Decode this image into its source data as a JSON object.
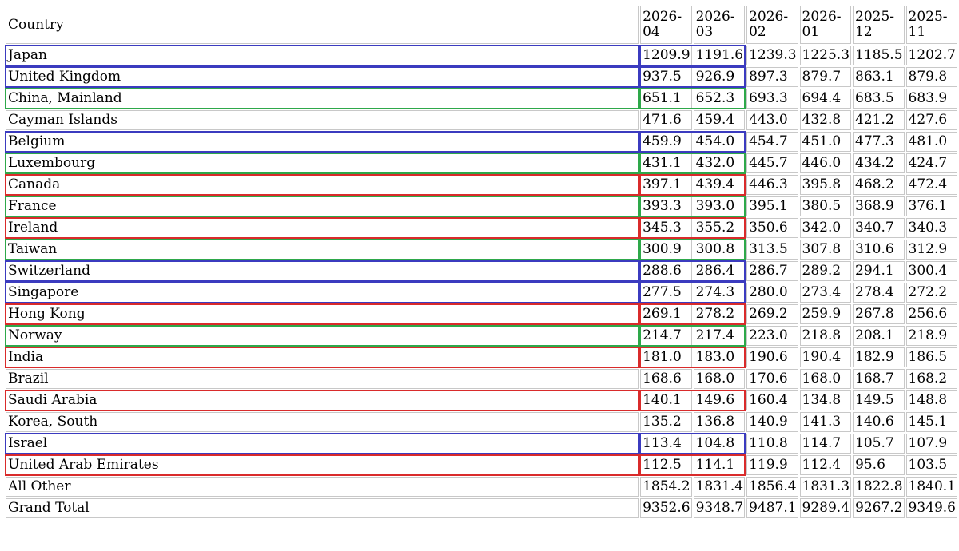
{
  "header": {
    "country": "Country",
    "periods": [
      [
        "2026-",
        "04"
      ],
      [
        "2026-",
        "03"
      ],
      [
        "2026-",
        "02"
      ],
      [
        "2026-",
        "01"
      ],
      [
        "2025-",
        "12"
      ],
      [
        "2025-",
        "11"
      ]
    ]
  },
  "rows": [
    {
      "country": "Japan",
      "values": [
        "1209.9",
        "1191.6",
        "1239.3",
        "1225.3",
        "1185.5",
        "1202.7"
      ],
      "highlight": "#3b3bbf"
    },
    {
      "country": "United Kingdom",
      "values": [
        "937.5",
        "926.9",
        "897.3",
        "879.7",
        "863.1",
        "879.8"
      ],
      "highlight": "#3b3bbf"
    },
    {
      "country": "China, Mainland",
      "values": [
        "651.1",
        "652.3",
        "693.3",
        "694.4",
        "683.5",
        "683.9"
      ],
      "highlight": "#2ea84a"
    },
    {
      "country": "Cayman Islands",
      "values": [
        "471.6",
        "459.4",
        "443.0",
        "432.8",
        "421.2",
        "427.6"
      ],
      "highlight": null
    },
    {
      "country": "Belgium",
      "values": [
        "459.9",
        "454.0",
        "454.7",
        "451.0",
        "477.3",
        "481.0"
      ],
      "highlight": "#3b3bbf"
    },
    {
      "country": "Luxembourg",
      "values": [
        "431.1",
        "432.0",
        "445.7",
        "446.0",
        "434.2",
        "424.7"
      ],
      "highlight": "#2ea84a"
    },
    {
      "country": "Canada",
      "values": [
        "397.1",
        "439.4",
        "446.3",
        "395.8",
        "468.2",
        "472.4"
      ],
      "highlight": "#d92b2b"
    },
    {
      "country": "France",
      "values": [
        "393.3",
        "393.0",
        "395.1",
        "380.5",
        "368.9",
        "376.1"
      ],
      "highlight": "#2ea84a"
    },
    {
      "country": "Ireland",
      "values": [
        "345.3",
        "355.2",
        "350.6",
        "342.0",
        "340.7",
        "340.3"
      ],
      "highlight": "#d92b2b"
    },
    {
      "country": "Taiwan",
      "values": [
        "300.9",
        "300.8",
        "313.5",
        "307.8",
        "310.6",
        "312.9"
      ],
      "highlight": "#2ea84a"
    },
    {
      "country": "Switzerland",
      "values": [
        "288.6",
        "286.4",
        "286.7",
        "289.2",
        "294.1",
        "300.4"
      ],
      "highlight": "#3b3bbf"
    },
    {
      "country": "Singapore",
      "values": [
        "277.5",
        "274.3",
        "280.0",
        "273.4",
        "278.4",
        "272.2"
      ],
      "highlight": "#3b3bbf"
    },
    {
      "country": "Hong Kong",
      "values": [
        "269.1",
        "278.2",
        "269.2",
        "259.9",
        "267.8",
        "256.6"
      ],
      "highlight": "#d92b2b"
    },
    {
      "country": "Norway",
      "values": [
        "214.7",
        "217.4",
        "223.0",
        "218.8",
        "208.1",
        "218.9"
      ],
      "highlight": "#2ea84a"
    },
    {
      "country": "India",
      "values": [
        "181.0",
        "183.0",
        "190.6",
        "190.4",
        "182.9",
        "186.5"
      ],
      "highlight": "#d92b2b"
    },
    {
      "country": "Brazil",
      "values": [
        "168.6",
        "168.0",
        "170.6",
        "168.0",
        "168.7",
        "168.2"
      ],
      "highlight": null
    },
    {
      "country": "Saudi Arabia",
      "values": [
        "140.1",
        "149.6",
        "160.4",
        "134.8",
        "149.5",
        "148.8"
      ],
      "highlight": "#d92b2b"
    },
    {
      "country": "Korea, South",
      "values": [
        "135.2",
        "136.8",
        "140.9",
        "141.3",
        "140.6",
        "145.1"
      ],
      "highlight": null
    },
    {
      "country": "Israel",
      "values": [
        "113.4",
        "104.8",
        "110.8",
        "114.7",
        "105.7",
        "107.9"
      ],
      "highlight": "#3b3bbf"
    },
    {
      "country": "United Arab Emirates",
      "values": [
        "112.5",
        "114.1",
        "119.9",
        "112.4",
        "95.6",
        "103.5"
      ],
      "highlight": "#d92b2b"
    },
    {
      "country": "All Other",
      "values": [
        "1854.2",
        "1831.4",
        "1856.4",
        "1831.3",
        "1822.8",
        "1840.1"
      ],
      "highlight": null
    },
    {
      "country": "Grand Total",
      "values": [
        "9352.6",
        "9348.7",
        "9487.1",
        "9289.4",
        "9267.2",
        "9349.6"
      ],
      "highlight": null
    }
  ]
}
